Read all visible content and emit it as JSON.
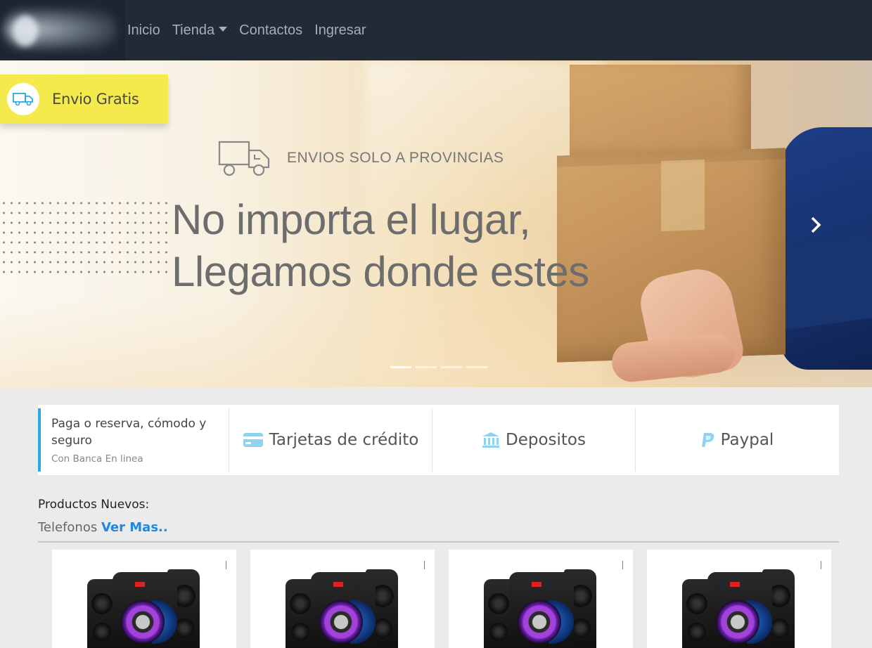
{
  "nav": {
    "links": [
      {
        "label": "Inicio"
      },
      {
        "label": "Tienda",
        "has_dropdown": true
      },
      {
        "label": "Contactos"
      },
      {
        "label": "Ingresar"
      }
    ]
  },
  "hero": {
    "badge": "Envio Gratis",
    "shipping_label": "ENVIOS SOLO A PROVINCIAS",
    "headline_line1": "No importa el lugar,",
    "headline_line2": "Llegamos donde estes",
    "active_slide": 1,
    "slide_count": 4
  },
  "payments": {
    "title": "Paga o reserva, cómodo y seguro",
    "subtitle": "Con Banca En linea",
    "methods": [
      {
        "label": "Tarjetas de crédito",
        "icon": "credit-card-icon"
      },
      {
        "label": "Depositos",
        "icon": "bank-icon"
      },
      {
        "label": "Paypal",
        "icon": "paypal-icon"
      }
    ],
    "icon_color": "#8fd3f0"
  },
  "products": {
    "section_title": "Productos Nuevos:",
    "category": "Telefonos",
    "more_link": "Ver Mas..",
    "items": [
      {
        "image": "speaker-system"
      },
      {
        "image": "speaker-system"
      },
      {
        "image": "speaker-system"
      },
      {
        "image": "speaker-system"
      }
    ]
  },
  "colors": {
    "navbar": "#222a36",
    "badge": "#f4ea4c",
    "accent": "#29a9e0",
    "link": "#1e88e5"
  }
}
